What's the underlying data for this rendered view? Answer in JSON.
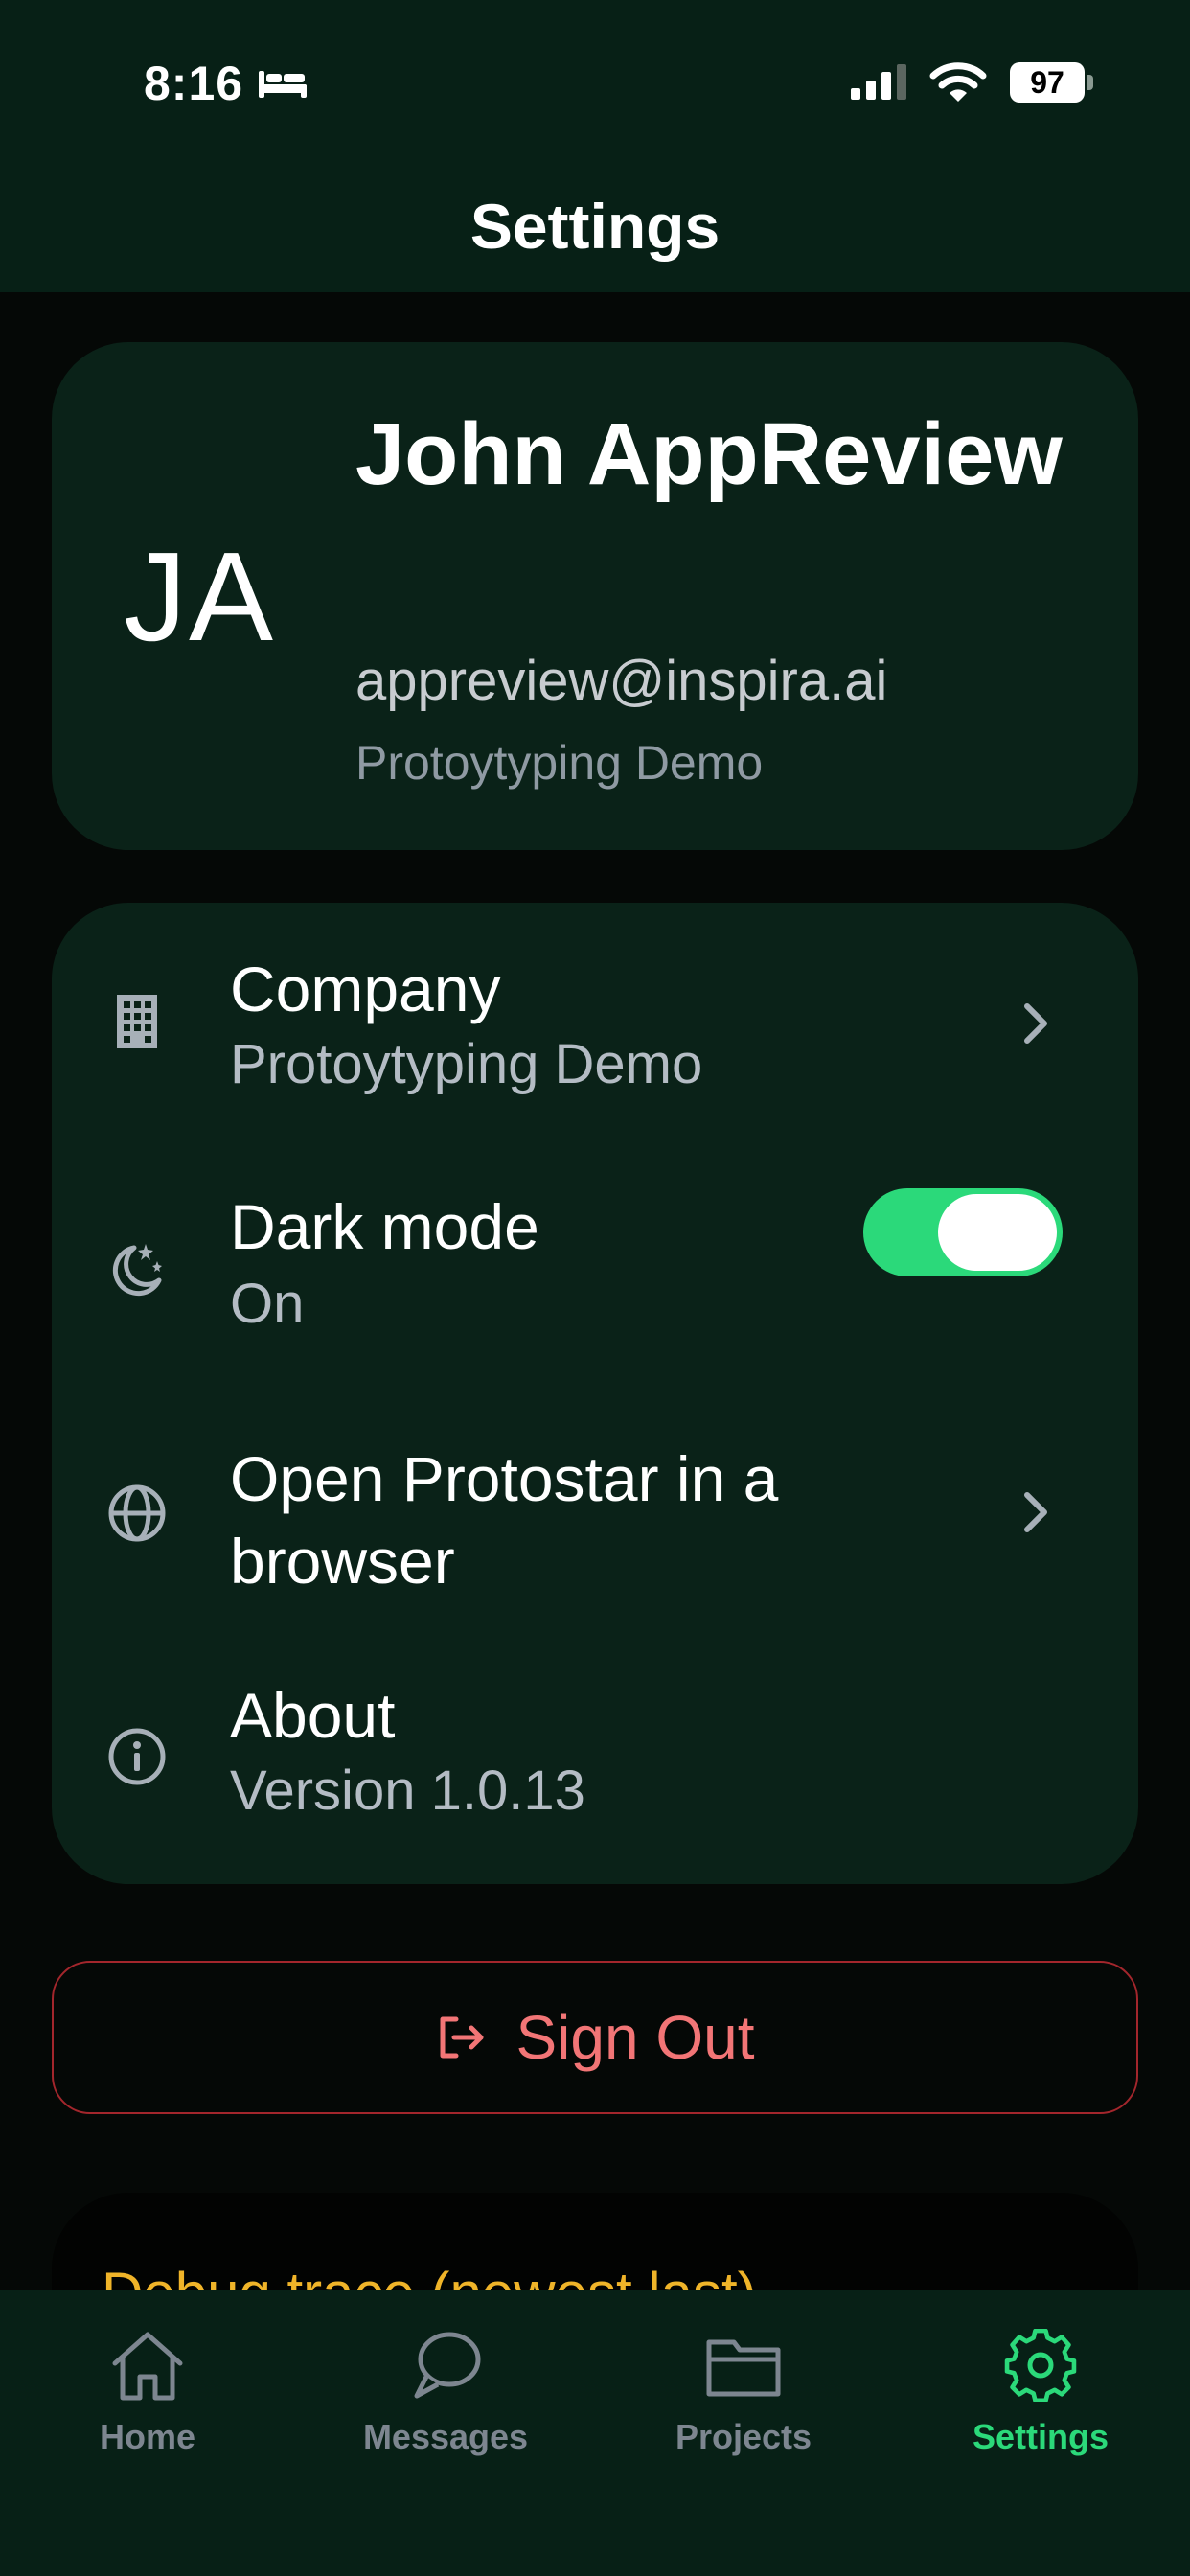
{
  "status_bar": {
    "time": "8:16",
    "battery": "97"
  },
  "header": {
    "title": "Settings"
  },
  "profile": {
    "initials": "JA",
    "name": "John AppReview",
    "email": "appreview@inspira.ai",
    "organization": "Protoytyping Demo"
  },
  "settings": {
    "company": {
      "title": "Company",
      "subtitle": "Protoytyping Demo"
    },
    "dark_mode": {
      "title": "Dark mode",
      "subtitle": "On",
      "enabled": true
    },
    "browser": {
      "title": "Open Protostar in a browser"
    },
    "about": {
      "title": "About",
      "subtitle": "Version 1.0.13"
    }
  },
  "sign_out": {
    "label": "Sign Out"
  },
  "debug": {
    "title": "Debug trace (newest last)"
  },
  "tabbar": {
    "tabs": [
      {
        "label": "Home",
        "icon": "home-icon"
      },
      {
        "label": "Messages",
        "icon": "messages-icon"
      },
      {
        "label": "Projects",
        "icon": "folder-icon"
      },
      {
        "label": "Settings",
        "icon": "gear-icon",
        "active": true
      }
    ]
  },
  "colors": {
    "accent": "#2bd97a",
    "danger": "#f27576",
    "debug": "#f0b429",
    "card": "#0a2218",
    "header": "#072016"
  }
}
